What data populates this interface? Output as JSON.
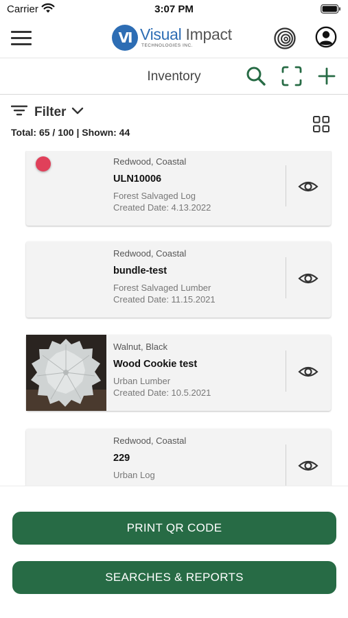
{
  "status_bar": {
    "carrier": "Carrier",
    "time": "3:07 PM"
  },
  "header": {
    "logo": {
      "mark": "VI",
      "name_part1": "Visual",
      "name_part2": "Impact",
      "subtitle": "TECHNOLOGIES INC."
    },
    "icons": [
      "menu-icon",
      "tree-rings-icon",
      "profile-icon"
    ]
  },
  "toolbar": {
    "title": "Inventory",
    "icons": [
      "search-icon",
      "scan-icon",
      "add-icon"
    ],
    "accent_color": "#276b45"
  },
  "filter": {
    "label": "Filter",
    "totals": "Total: 65 / 100 | Shown: 44"
  },
  "items": [
    {
      "species": "Redwood, Coastal",
      "id": "ULN10006",
      "category": "Forest Salvaged Log",
      "created": "Created Date: 4.13.2022",
      "has_status_dot": true,
      "status_color": "#e0405a"
    },
    {
      "species": "Redwood, Coastal",
      "id": "bundle-test",
      "category": "Forest Salvaged Lumber",
      "created": "Created Date: 11.15.2021"
    },
    {
      "species": "Walnut, Black",
      "id": "Wood Cookie test",
      "category": "Urban Lumber",
      "created": "Created Date: 10.5.2021",
      "has_photo": true
    },
    {
      "species": "Redwood, Coastal",
      "id": "229",
      "category": "Urban Log",
      "created": ""
    }
  ],
  "actions": {
    "print_qr": "PRINT QR CODE",
    "searches_reports": "SEARCHES & REPORTS",
    "button_color": "#276b45"
  }
}
